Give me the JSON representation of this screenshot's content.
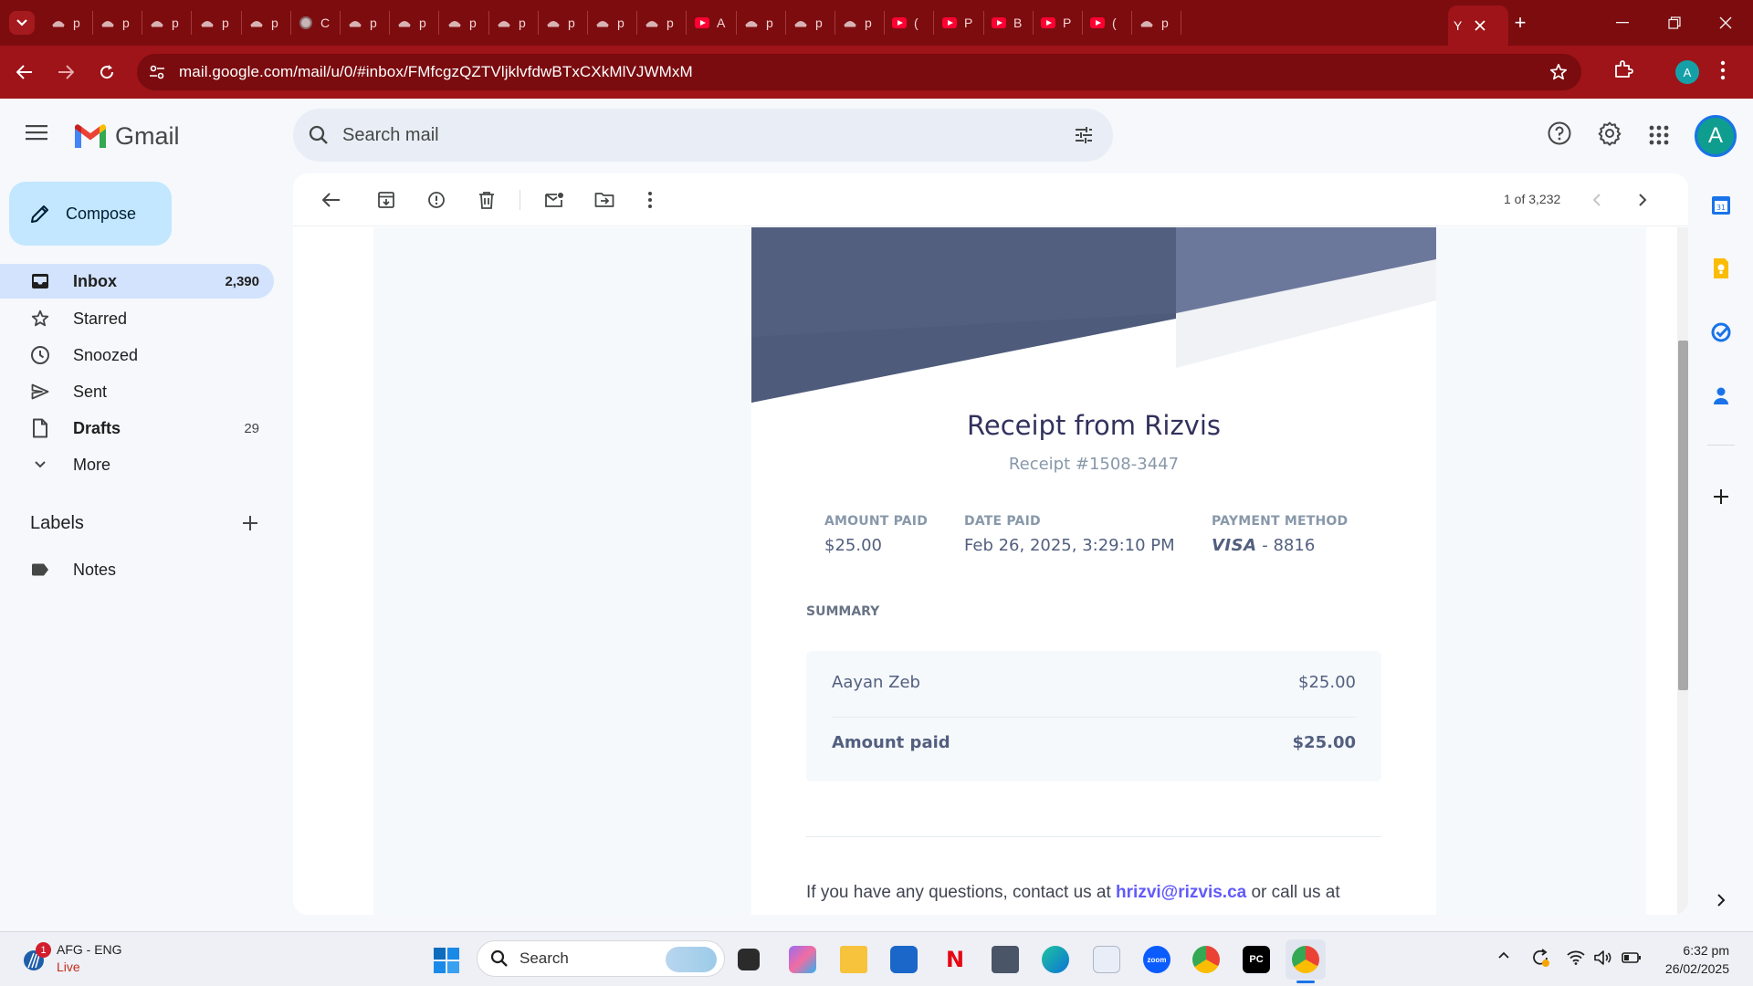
{
  "browser": {
    "tabs": [
      {
        "label": "p",
        "icon": "site-icon"
      },
      {
        "label": "p",
        "icon": "site-icon"
      },
      {
        "label": "p",
        "icon": "site-icon"
      },
      {
        "label": "p",
        "icon": "site-icon"
      },
      {
        "label": "p",
        "icon": "site-icon"
      },
      {
        "label": "C",
        "icon": "globe-icon"
      },
      {
        "label": "p",
        "icon": "site-icon"
      },
      {
        "label": "p",
        "icon": "site-icon"
      },
      {
        "label": "p",
        "icon": "site-icon"
      },
      {
        "label": "p",
        "icon": "site-icon"
      },
      {
        "label": "p",
        "icon": "site-icon"
      },
      {
        "label": "p",
        "icon": "site-icon"
      },
      {
        "label": "p",
        "icon": "site-icon"
      },
      {
        "label": "A",
        "icon": "youtube-icon"
      },
      {
        "label": "p",
        "icon": "site-icon"
      },
      {
        "label": "p",
        "icon": "site-icon"
      },
      {
        "label": "p",
        "icon": "site-icon"
      },
      {
        "label": "(",
        "icon": "youtube-icon"
      },
      {
        "label": "P",
        "icon": "youtube-icon"
      },
      {
        "label": "B",
        "icon": "youtube-icon"
      },
      {
        "label": "P",
        "icon": "youtube-icon"
      },
      {
        "label": "(",
        "icon": "youtube-icon"
      },
      {
        "label": "p",
        "icon": "site-icon"
      }
    ],
    "active_tab_label": "Y",
    "url": "mail.google.com/mail/u/0/#inbox/FMfcgzQZTVljklvfdwBTxCXkMlVJWMxM",
    "profile_initial": "A",
    "theme_color": "#9e1418"
  },
  "gmail": {
    "logo_text": "Gmail",
    "search_placeholder": "Search mail",
    "avatar_initial": "A",
    "compose_label": "Compose",
    "nav": [
      {
        "label": "Inbox",
        "count": "2,390",
        "icon": "inbox-icon"
      },
      {
        "label": "Starred",
        "count": "",
        "icon": "star-icon"
      },
      {
        "label": "Snoozed",
        "count": "",
        "icon": "clock-icon"
      },
      {
        "label": "Sent",
        "count": "",
        "icon": "send-icon"
      },
      {
        "label": "Drafts",
        "count": "29",
        "icon": "draft-icon"
      },
      {
        "label": "More",
        "count": "",
        "icon": "chevron-down-icon"
      }
    ],
    "labels_title": "Labels",
    "labels": [
      {
        "label": "Notes",
        "icon": "label-icon"
      }
    ],
    "pager": "1 of 3,232"
  },
  "receipt": {
    "title": "Receipt from Rizvis",
    "number": "Receipt #1508-3447",
    "amount_paid_label": "AMOUNT PAID",
    "amount_paid": "$25.00",
    "date_paid_label": "DATE PAID",
    "date_paid": "Feb 26, 2025, 3:29:10 PM",
    "payment_method_label": "PAYMENT METHOD",
    "card_brand": "VISA",
    "card_last4": "- 8816",
    "summary_label": "SUMMARY",
    "line_item_name": "Aayan Zeb",
    "line_item_amount": "$25.00",
    "total_label": "Amount paid",
    "total_amount": "$25.00",
    "footer_prefix": "If you have any questions, contact us at ",
    "footer_email": "hrizvi@rizvis.ca",
    "footer_suffix": " or call us at",
    "banner_color": "#525f7f"
  },
  "taskbar": {
    "weather_title": "AFG - ENG",
    "weather_sub": "Live",
    "weather_badge": "1",
    "search_label": "Search",
    "time": "6:32 pm",
    "date": "26/02/2025"
  }
}
